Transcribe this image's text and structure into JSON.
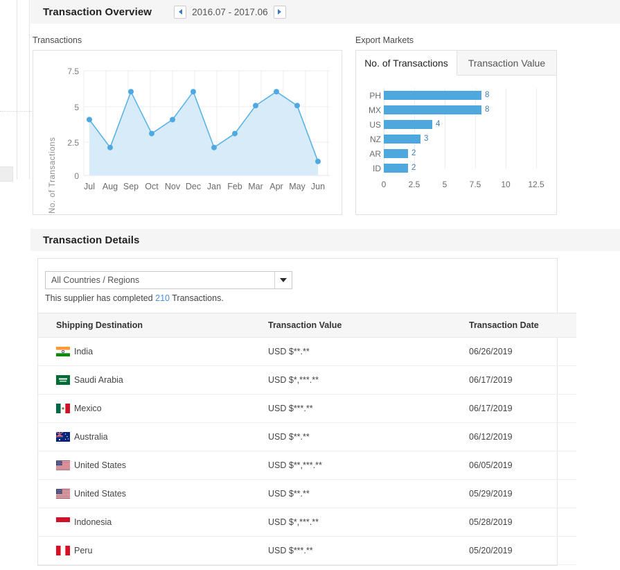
{
  "overview": {
    "title": "Transaction Overview",
    "pager": {
      "prev_icon": "triangle-left-icon",
      "next_icon": "triangle-right-icon",
      "range": "2016.07 - 2017.06"
    },
    "line_caption": "Transactions",
    "bar_caption": "Export Markets",
    "tabs": [
      {
        "label": "No. of Transactions",
        "active": true
      },
      {
        "label": "Transaction Value",
        "active": false
      }
    ]
  },
  "details": {
    "title": "Transaction Details",
    "filter": {
      "value": "All Countries / Regions",
      "caret_icon": "chevron-down-icon"
    },
    "note_prefix": "This supplier has completed",
    "note_count": "210",
    "note_suffix": "Transactions.",
    "columns": [
      "Shipping Destination",
      "Transaction Value",
      "Transaction Date"
    ],
    "rows": [
      {
        "country": "India",
        "flag": "in",
        "value": "USD $**.**",
        "date": "06/26/2019"
      },
      {
        "country": "Saudi Arabia",
        "flag": "sa",
        "value": "USD $*,***.**",
        "date": "06/17/2019"
      },
      {
        "country": "Mexico",
        "flag": "mx",
        "value": "USD $***.**",
        "date": "06/17/2019"
      },
      {
        "country": "Australia",
        "flag": "au",
        "value": "USD $**.**",
        "date": "06/12/2019"
      },
      {
        "country": "United States",
        "flag": "us",
        "value": "USD $**,***.**",
        "date": "06/05/2019"
      },
      {
        "country": "United States",
        "flag": "us",
        "value": "USD $**.**",
        "date": "05/29/2019"
      },
      {
        "country": "Indonesia",
        "flag": "id",
        "value": "USD $*,***.**",
        "date": "05/28/2019"
      },
      {
        "country": "Peru",
        "flag": "pe",
        "value": "USD $***.**",
        "date": "05/20/2019"
      }
    ]
  },
  "colors": {
    "accent_blue": "#4ea8dd",
    "area_fill": "#d7ecf8",
    "link_blue": "#4a90d9",
    "header_bg": "#f5f5f5"
  },
  "chart_data": [
    {
      "type": "area",
      "title": "Transactions",
      "xlabel": "",
      "ylabel": "No. of Transactions",
      "categories": [
        "Jul",
        "Aug",
        "Sep",
        "Oct",
        "Nov",
        "Dec",
        "Jan",
        "Feb",
        "Mar",
        "Apr",
        "May",
        "Jun"
      ],
      "values": [
        4,
        2,
        6,
        3,
        4,
        6,
        2,
        3,
        5,
        6,
        5,
        1
      ],
      "yticks": [
        "0",
        "2.5",
        "5",
        "7.5"
      ],
      "ylim": [
        0,
        7.5
      ],
      "grid": true,
      "legend": "none",
      "line_color": "#5bb3e4",
      "fill_color": "#d7ecf8"
    },
    {
      "type": "bar",
      "orientation": "horizontal",
      "title": "Export Markets",
      "xlabel": "",
      "ylabel": "",
      "categories": [
        "PH",
        "MX",
        "US",
        "NZ",
        "AR",
        "ID"
      ],
      "values": [
        8,
        8,
        4,
        3,
        2,
        2
      ],
      "xticks": [
        "0",
        "2.5",
        "5",
        "7.5",
        "10",
        "12.5"
      ],
      "xlim": [
        0,
        13.75
      ],
      "grid": true,
      "legend": "none",
      "bar_color": "#4ea8dd",
      "data_labels": [
        "8",
        "8",
        "4",
        "3",
        "2",
        "2"
      ]
    }
  ]
}
